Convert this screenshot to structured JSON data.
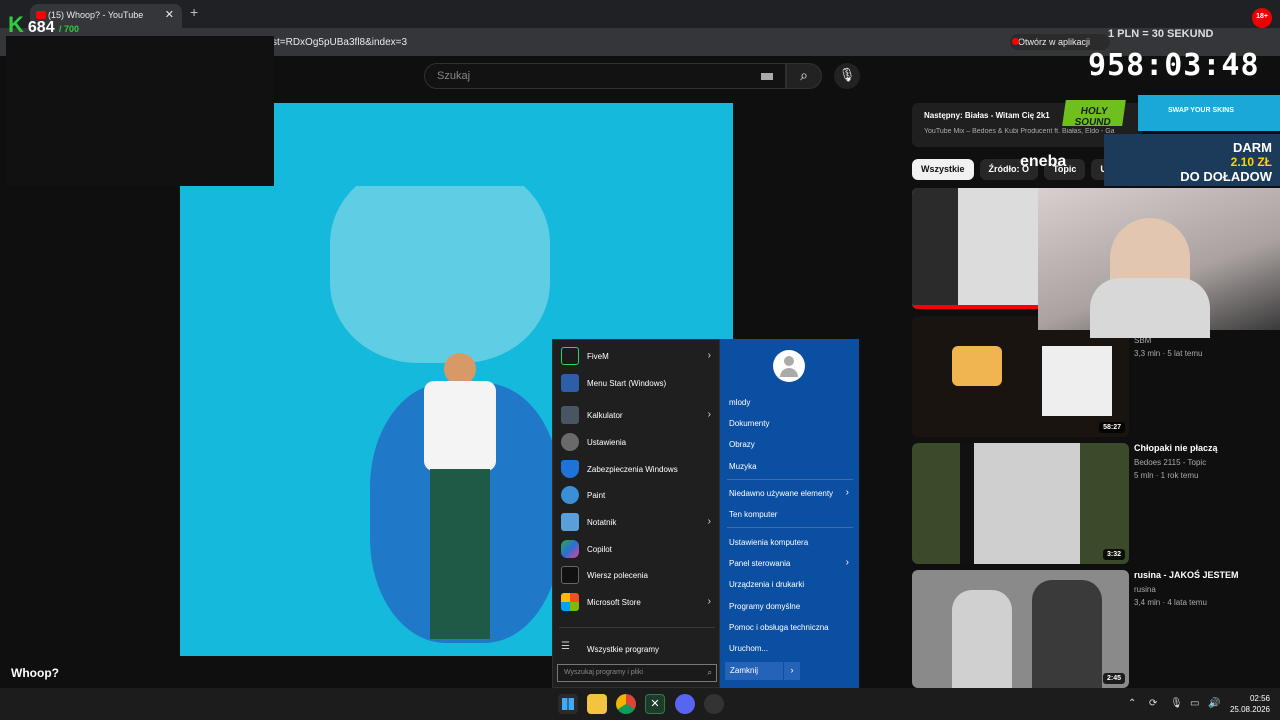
{
  "browser": {
    "tab_title": "(15) Whoop? - YouTube",
    "url_partial": "st=RDxOg5pUBa3fl8&index=3",
    "open_in_app": "Otwórz w aplikacji"
  },
  "youtube": {
    "search_placeholder": "Szukaj",
    "video_title": "Whoop?",
    "next_label": "Następny: Białas - Witam Cię 2k1",
    "next_sub": "YouTube Mix – Bedoes & Kubi Producent ft. Białas, Eldo - Ga",
    "chips": [
      "Wszystkie",
      "Źródło: O",
      "Topic",
      "Uki"
    ],
    "recommendations": [
      {
        "title": "",
        "channel": "SBM",
        "stats": "3,3 mln · 5 lat temu",
        "duration": "58:27"
      },
      {
        "title": "Chłopaki nie płaczą",
        "channel": "Bedoes 2115 - Topic",
        "stats": "5 mln · 1 rok temu",
        "duration": "3:32"
      },
      {
        "title": "rusina - JAKOŚ JESTEM",
        "channel": "rusina",
        "stats": "3,4 mln · 4 lata temu",
        "duration": "2:45"
      }
    ],
    "first_duration": ""
  },
  "overlay": {
    "counter_k": "K",
    "counter_value": "684",
    "counter_max": "/ 700",
    "timer_label": "1 PLN = 30 SEKUND",
    "timer": "958:03:48",
    "age_badge": "18+",
    "ad_swap": "SWAP YOUR SKINS",
    "ad_darm_l1": "DARM",
    "ad_darm_l2": "2.10 ZŁ",
    "ad_darm_l3": "DO DOŁADOW",
    "logo_holy": "HOLY SOUND",
    "logo_enebа": "eneba"
  },
  "start_menu": {
    "left_items": [
      {
        "label": "FiveM",
        "icon": "fivem-icon",
        "color": "#1b1b1b",
        "submenu": true
      },
      {
        "label": "Menu Start (Windows)",
        "icon": "start-menu-icon",
        "color": "#2c5fa8",
        "submenu": false
      },
      {
        "label": "Kalkulator",
        "icon": "calculator-icon",
        "color": "#4a5563",
        "submenu": true
      },
      {
        "label": "Ustawienia",
        "icon": "settings-icon",
        "color": "#6a6a6a",
        "submenu": false
      },
      {
        "label": "Zabezpieczenia Windows",
        "icon": "shield-icon",
        "color": "#1e73d8",
        "submenu": false
      },
      {
        "label": "Paint",
        "icon": "paint-icon",
        "color": "#3a8fd6",
        "submenu": false
      },
      {
        "label": "Notatnik",
        "icon": "notepad-icon",
        "color": "#5aa0d8",
        "submenu": true
      },
      {
        "label": "Copilot",
        "icon": "copilot-icon",
        "color": "#22a0a0",
        "submenu": false
      },
      {
        "label": "Wiersz polecenia",
        "icon": "terminal-icon",
        "color": "#111111",
        "submenu": false
      },
      {
        "label": "Microsoft Store",
        "icon": "store-icon",
        "color": "#e8e8e8",
        "submenu": true
      }
    ],
    "all_programs": "Wszystkie programy",
    "search_placeholder": "Wyszukaj programy i pliki",
    "right_items": [
      {
        "label": "mlody",
        "submenu": false
      },
      {
        "label": "Dokumenty",
        "submenu": false
      },
      {
        "label": "Obrazy",
        "submenu": false
      },
      {
        "label": "Muzyka",
        "submenu": false
      },
      {
        "label": "Niedawno używane elementy",
        "submenu": true
      },
      {
        "label": "Ten komputer",
        "submenu": false
      },
      {
        "label": "Ustawienia komputera",
        "submenu": false
      },
      {
        "label": "Panel sterowania",
        "submenu": true
      },
      {
        "label": "Urządzenia i drukarki",
        "submenu": false
      },
      {
        "label": "Programy domyślne",
        "submenu": false
      },
      {
        "label": "Pomoc i obsługa techniczna",
        "submenu": false
      },
      {
        "label": "Uruchom...",
        "submenu": false
      }
    ],
    "shutdown": "Zamknij"
  },
  "taskbar": {
    "time": "02:56",
    "date": "25.08.2026",
    "icons": [
      "windows-start-icon",
      "file-explorer-icon",
      "chrome-icon",
      "excel-icon",
      "discord-icon",
      "app-icon"
    ]
  }
}
